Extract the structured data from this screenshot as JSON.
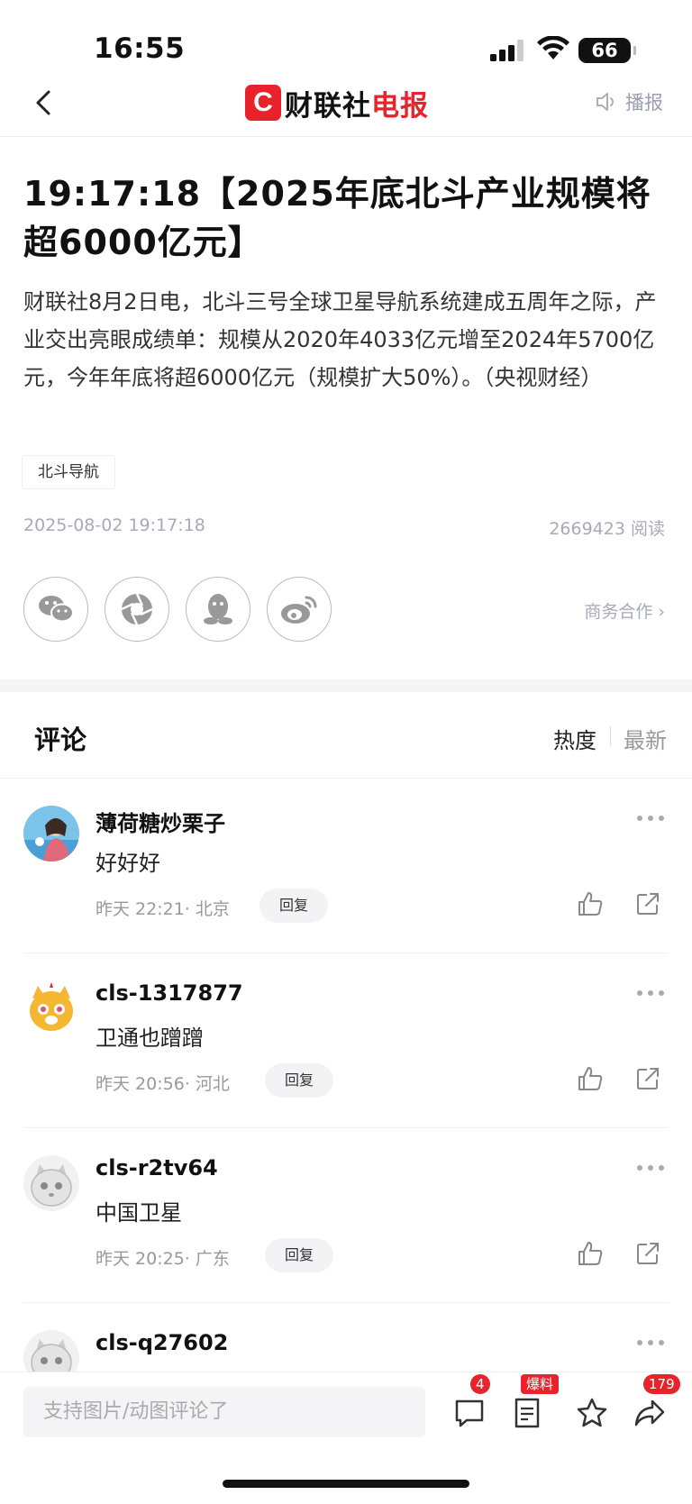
{
  "status_bar": {
    "time": "16:55",
    "battery": "66"
  },
  "nav": {
    "logo_mark": "C",
    "logo_name": "财联社",
    "logo_name2": "电报",
    "broadcast": "播报"
  },
  "article": {
    "title": "19:17:18【2025年底北斗产业规模将超6000亿元】",
    "body": "财联社8月2日电，北斗三号全球卫星导航系统建成五周年之际，产业交出亮眼成绩单：规模从2020年4033亿元增至2024年5700亿元，今年年底将超6000亿元（规模扩大50%）。（央视财经）",
    "tag": "北斗导航",
    "date": "2025-08-02 19:17:18",
    "reads": "2669423 阅读",
    "business": "商务合作 ›"
  },
  "share_icons": [
    "wechat-icon",
    "moments-icon",
    "qq-icon",
    "weibo-icon"
  ],
  "comments_header": {
    "label": "评论",
    "sort_hot": "热度",
    "sort_new": "最新"
  },
  "comments": [
    {
      "user": "薄荷糖炒栗子",
      "text": "好好好",
      "time": "昨天 22:21· 北京",
      "reply": "回复"
    },
    {
      "user": "cls-1317877",
      "text": "卫通也蹭蹭",
      "time": "昨天 20:56· 河北",
      "reply": "回复"
    },
    {
      "user": "cls-r2tv64",
      "text": "中国卫星",
      "time": "昨天 20:25· 广东",
      "reply": "回复"
    },
    {
      "user": "cls-q27602",
      "text": "",
      "time": "",
      "reply": ""
    }
  ],
  "bottom_bar": {
    "input_placeholder": "支持图片/动图评论了",
    "comment_count": "4",
    "report_badge": "爆料",
    "share_count": "179"
  }
}
